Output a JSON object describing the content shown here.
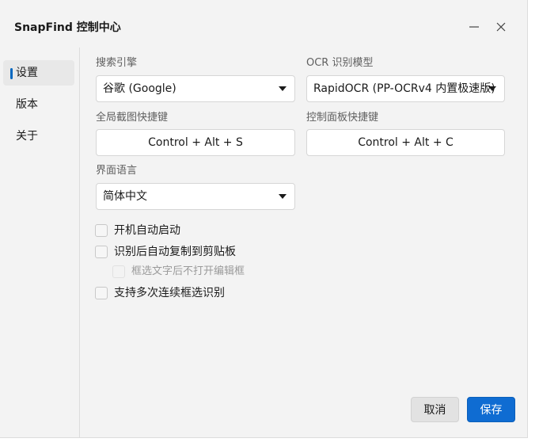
{
  "window": {
    "title": "SnapFind 控制中心",
    "minimize_icon": "minimize-icon",
    "close_icon": "close-icon"
  },
  "sidebar": {
    "items": [
      {
        "label": "设置",
        "active": true
      },
      {
        "label": "版本",
        "active": false
      },
      {
        "label": "关于",
        "active": false
      }
    ]
  },
  "settings": {
    "search_engine": {
      "label": "搜索引擎",
      "value": "谷歌 (Google)"
    },
    "ocr_model": {
      "label": "OCR 识别模型",
      "value": "RapidOCR (PP-OCRv4 内置极速版)"
    },
    "global_hotkey": {
      "label": "全局截图快捷键",
      "value": "Control + Alt + S"
    },
    "panel_hotkey": {
      "label": "控制面板快捷键",
      "value": "Control + Alt + C"
    },
    "language": {
      "label": "界面语言",
      "value": "简体中文"
    },
    "options": [
      {
        "label": "开机自动启动",
        "checked": false,
        "disabled": false
      },
      {
        "label": "识别后自动复制到剪贴板",
        "checked": false,
        "disabled": false
      },
      {
        "label": "框选文字后不打开编辑框",
        "checked": false,
        "disabled": true
      },
      {
        "label": "支持多次连续框选识别",
        "checked": false,
        "disabled": false
      }
    ]
  },
  "footer": {
    "cancel_label": "取消",
    "save_label": "保存"
  },
  "colors": {
    "accent": "#0f6cd2",
    "window_bg": "#f3f3f3"
  }
}
